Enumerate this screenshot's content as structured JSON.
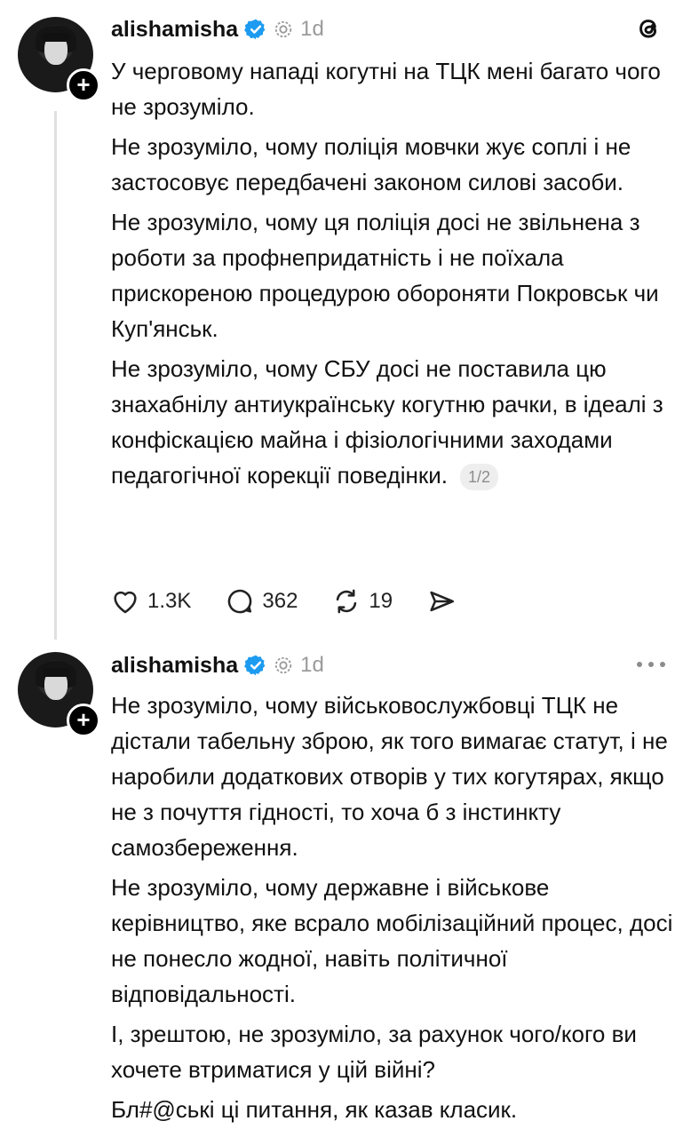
{
  "posts": [
    {
      "username": "alishamisha",
      "time": "1d",
      "paragraphs": [
        "У черговому нападі когутні на ТЦК мені багато чого не зрозуміло.",
        "Не зрозуміло, чому поліція мовчки жує соплі і не застосовує передбачені законом силові засоби.",
        "Не зрозуміло,  чому ця поліція досі не звільнена з роботи за профнепридатність і не поїхала прискореною процедурою обороняти Покровськ чи Куп'янськ.",
        "Не зрозуміло, чому СБУ досі не поставила цю знахабнілу антиукраїнську когутню рачки, в ідеалі з конфіскацією майна і фізіологічними заходами педагогічної корекції поведінки."
      ],
      "page_indicator": "1/2",
      "likes": "1.3K",
      "comments": "362",
      "reposts": "19"
    },
    {
      "username": "alishamisha",
      "time": "1d",
      "paragraphs": [
        "Не зрозуміло, чому військовослужбовці ТЦК не дістали табельну зброю, як того вимагає статут, і не наробили додаткових отворів у тих когутярах, якщо не з почуття гідності,  то хоча б з інстинкту самозбереження.",
        "Не зрозуміло,  чому державне і військове керівництво, яке всрало мобілізаційний процес, досі не понесло жодної, навіть політичної відповідальності.",
        "І, зрештою,  не зрозуміло, за рахунок чого/кого ви хочете втриматися у цій війні?",
        "Бл#@ські ці питання, як казав класик."
      ]
    }
  ],
  "icons": {
    "verified": "verified-badge-icon",
    "threads_logo": "threads-logo-icon",
    "more": "more-options-icon",
    "like": "heart-icon",
    "comment": "comment-icon",
    "repost": "repost-icon",
    "share": "share-icon"
  },
  "colors": {
    "verified": "#1d9bf0",
    "text": "#111111",
    "muted": "#9a9a9a"
  }
}
